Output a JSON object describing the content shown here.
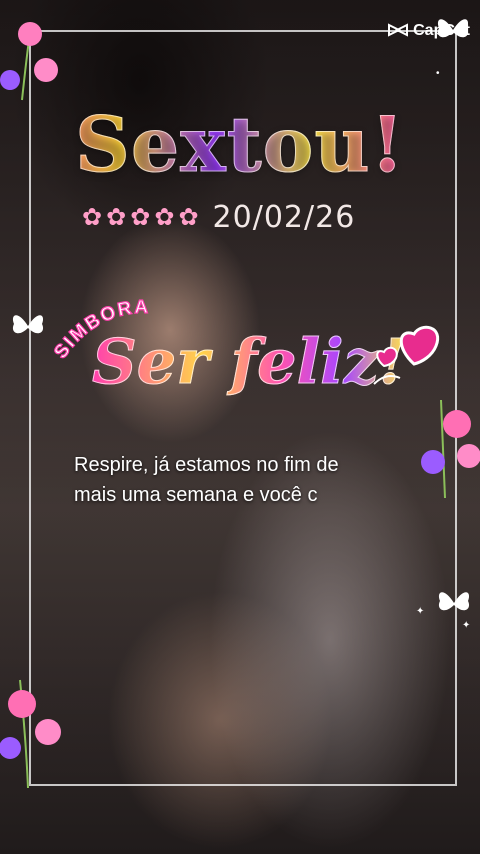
{
  "watermark": {
    "label": "CapCut",
    "icon": "capcut-logo-icon"
  },
  "greeting": {
    "title": "Sextou!",
    "date": "20/02/26"
  },
  "sticker": {
    "simbora": "SIMBORA",
    "feliz": "Ser feliz!"
  },
  "message": {
    "line1": "Respire, já estamos no fim de",
    "line2": "mais uma semana e você c"
  },
  "decor": {
    "flower_count": 5,
    "flower_icon": "cherry-blossom-icon",
    "heart_icon": "heart-icon",
    "butterfly_icon": "butterfly-icon"
  },
  "colors": {
    "pink": "#ff3fae",
    "yellow": "#ffd44a",
    "purple": "#a746ff",
    "frame": "#ffffff"
  }
}
